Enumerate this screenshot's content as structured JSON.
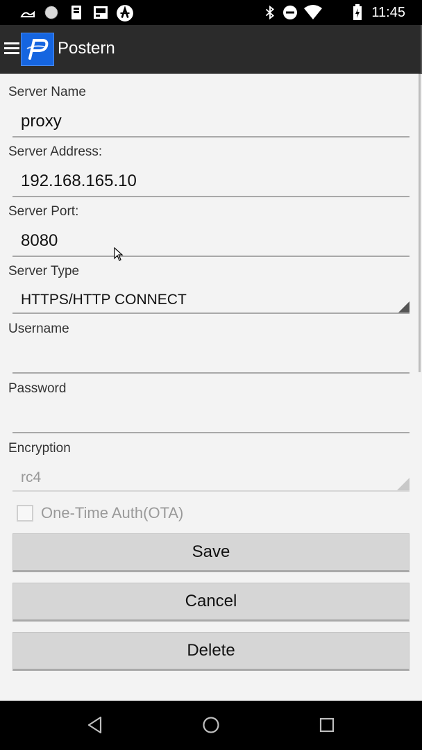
{
  "status_bar": {
    "time": "11:45",
    "icons_left": [
      "cast-icon",
      "circle-icon",
      "sim-icon",
      "screenshot-icon",
      "android-debug-icon"
    ],
    "icons_right": [
      "bluetooth-icon",
      "do-not-disturb-icon",
      "wifi-icon",
      "battery-charging-icon"
    ]
  },
  "app_bar": {
    "title": "Postern",
    "logo_letter": "P",
    "menu_icon": "hamburger-icon",
    "brand_color": "#1565e0"
  },
  "form": {
    "server_name": {
      "label": "Server Name",
      "value": "proxy"
    },
    "server_address": {
      "label": "Server Address:",
      "value": "192.168.165.10"
    },
    "server_port": {
      "label": "Server Port:",
      "value": "8080"
    },
    "server_type": {
      "label": "Server Type",
      "value": "HTTPS/HTTP CONNECT"
    },
    "username": {
      "label": "Username",
      "value": ""
    },
    "password": {
      "label": "Password",
      "value": ""
    },
    "encryption": {
      "label": "Encryption",
      "value": "rc4",
      "enabled": false
    },
    "ota": {
      "label": "One-Time Auth(OTA)",
      "checked": false,
      "enabled": false
    }
  },
  "buttons": {
    "save": "Save",
    "cancel": "Cancel",
    "delete": "Delete"
  },
  "nav_bar": {
    "back_icon": "back-triangle-icon",
    "home_icon": "home-circle-icon",
    "recents_icon": "recents-square-icon"
  }
}
